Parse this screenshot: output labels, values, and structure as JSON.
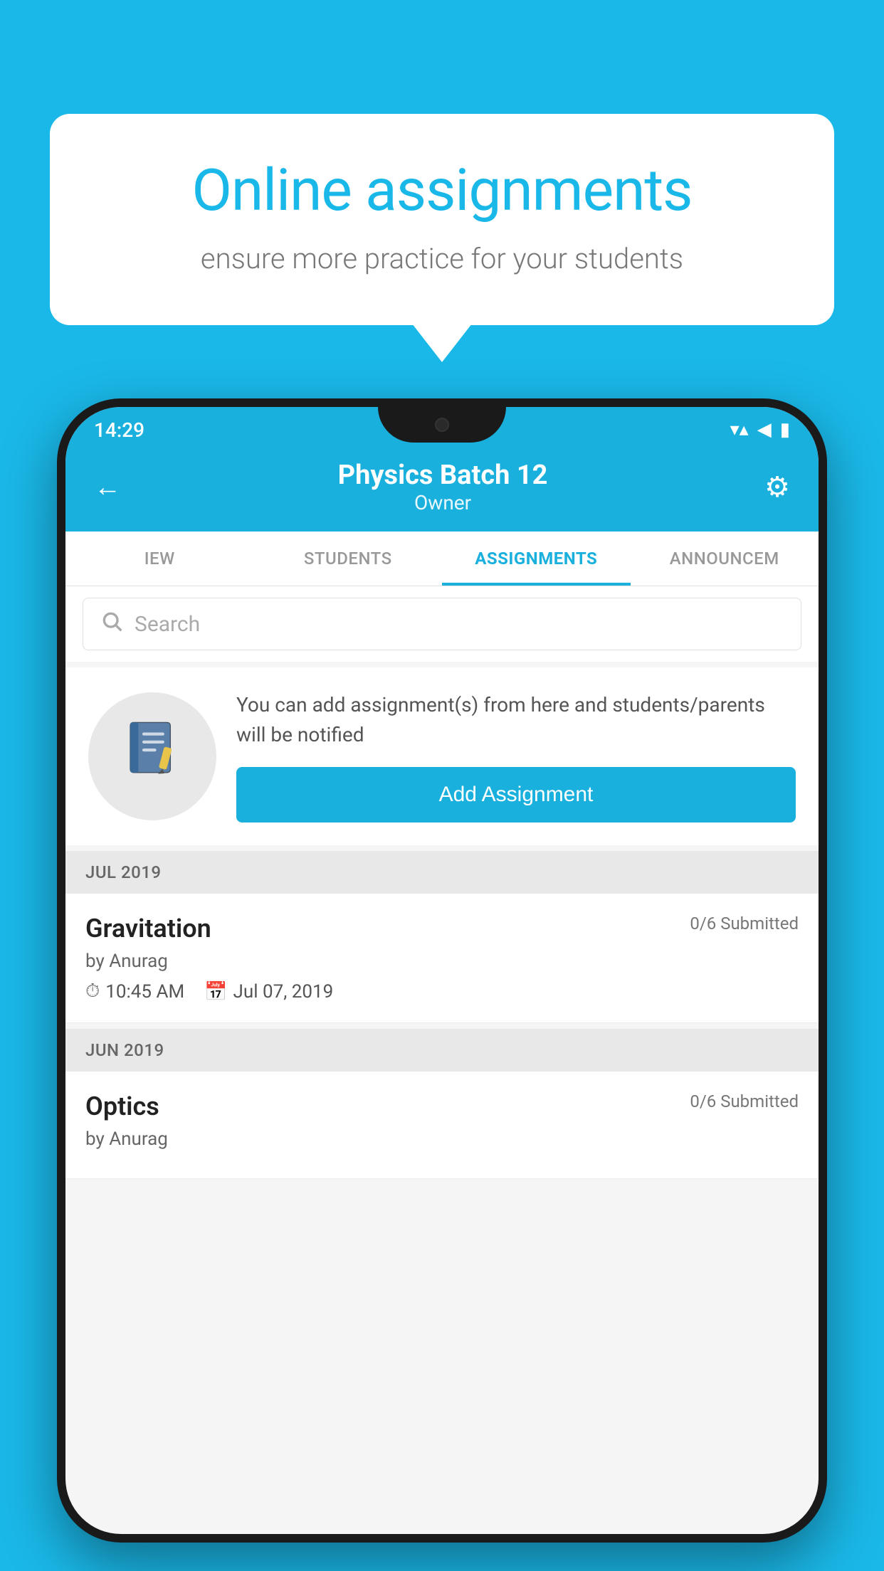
{
  "background": {
    "color": "#1ab8e8"
  },
  "speech_bubble": {
    "title": "Online assignments",
    "subtitle": "ensure more practice for your students"
  },
  "phone": {
    "status_bar": {
      "time": "14:29",
      "wifi_icon": "▼",
      "signal_icon": "◄",
      "battery_icon": "▮"
    },
    "header": {
      "title": "Physics Batch 12",
      "subtitle": "Owner",
      "back_label": "←",
      "settings_label": "⚙"
    },
    "tabs": [
      {
        "label": "IEW",
        "active": false
      },
      {
        "label": "STUDENTS",
        "active": false
      },
      {
        "label": "ASSIGNMENTS",
        "active": true
      },
      {
        "label": "ANNOUNCEM",
        "active": false
      }
    ],
    "search": {
      "placeholder": "Search"
    },
    "promo": {
      "text": "You can add assignment(s) from here and students/parents will be notified",
      "button_label": "Add Assignment"
    },
    "sections": [
      {
        "label": "JUL 2019",
        "assignments": [
          {
            "title": "Gravitation",
            "submitted": "0/6 Submitted",
            "by": "by Anurag",
            "time": "10:45 AM",
            "date": "Jul 07, 2019"
          }
        ]
      },
      {
        "label": "JUN 2019",
        "assignments": [
          {
            "title": "Optics",
            "submitted": "0/6 Submitted",
            "by": "by Anurag",
            "time": "",
            "date": ""
          }
        ]
      }
    ]
  }
}
